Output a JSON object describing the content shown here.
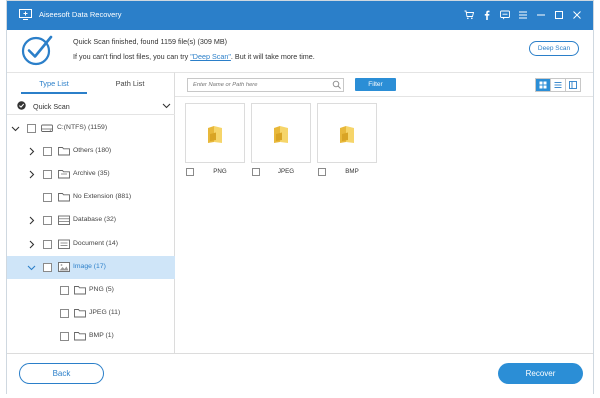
{
  "window": {
    "title": "Aiseesoft Data Recovery",
    "accent": "#2b7fc9",
    "controls": [
      "cart-icon",
      "facebook-icon",
      "feedback-icon",
      "menu-icon",
      "minimize-icon",
      "maximize-icon",
      "close-icon"
    ]
  },
  "status": {
    "line1": "Quick Scan finished, found 1159 file(s) (309 MB)",
    "line2_prefix": "If you can't find lost files, you can try ",
    "line2_link": "\"Deep Scan\"",
    "line2_suffix": ". But it will take more time.",
    "deep_scan_button": "Deep Scan"
  },
  "sidebar": {
    "tabs": [
      {
        "label": "Type List",
        "active": true
      },
      {
        "label": "Path List",
        "active": false
      }
    ],
    "scan_mode": "Quick Scan",
    "tree": [
      {
        "label": "C:(NTFS) (1159)",
        "icon": "drive-icon",
        "arrow": "chevron-down-icon",
        "level": 0,
        "selected": false
      },
      {
        "label": "Others (180)",
        "icon": "folder-icon",
        "arrow": "chevron-right-icon",
        "level": 1,
        "selected": false
      },
      {
        "label": "Archive (35)",
        "icon": "archive-icon",
        "arrow": "chevron-right-icon",
        "level": 1,
        "selected": false
      },
      {
        "label": "No Extension (881)",
        "icon": "blank-file-icon",
        "arrow": "",
        "level": 1,
        "selected": false
      },
      {
        "label": "Database (32)",
        "icon": "database-icon",
        "arrow": "chevron-right-icon",
        "level": 1,
        "selected": false
      },
      {
        "label": "Document (14)",
        "icon": "document-icon",
        "arrow": "chevron-right-icon",
        "level": 1,
        "selected": false
      },
      {
        "label": "Image (17)",
        "icon": "image-icon",
        "arrow": "chevron-down-icon",
        "level": 1,
        "selected": true
      },
      {
        "label": "PNG (5)",
        "icon": "folder-icon",
        "arrow": "",
        "level": 2,
        "selected": false
      },
      {
        "label": "JPEG (11)",
        "icon": "folder-icon",
        "arrow": "",
        "level": 2,
        "selected": false
      },
      {
        "label": "BMP (1)",
        "icon": "folder-icon",
        "arrow": "",
        "level": 2,
        "selected": false
      }
    ]
  },
  "main": {
    "search_placeholder": "Enter Name or Path here",
    "filter_button": "Filter",
    "view_modes": [
      "grid-view-icon",
      "list-view-icon",
      "detail-view-icon"
    ],
    "active_view": "grid-view-icon",
    "files": [
      {
        "label": "PNG",
        "icon": "folder-icon"
      },
      {
        "label": "JPEG",
        "icon": "folder-icon"
      },
      {
        "label": "BMP",
        "icon": "folder-icon"
      }
    ]
  },
  "footer": {
    "back_button": "Back",
    "recover_button": "Recover"
  }
}
